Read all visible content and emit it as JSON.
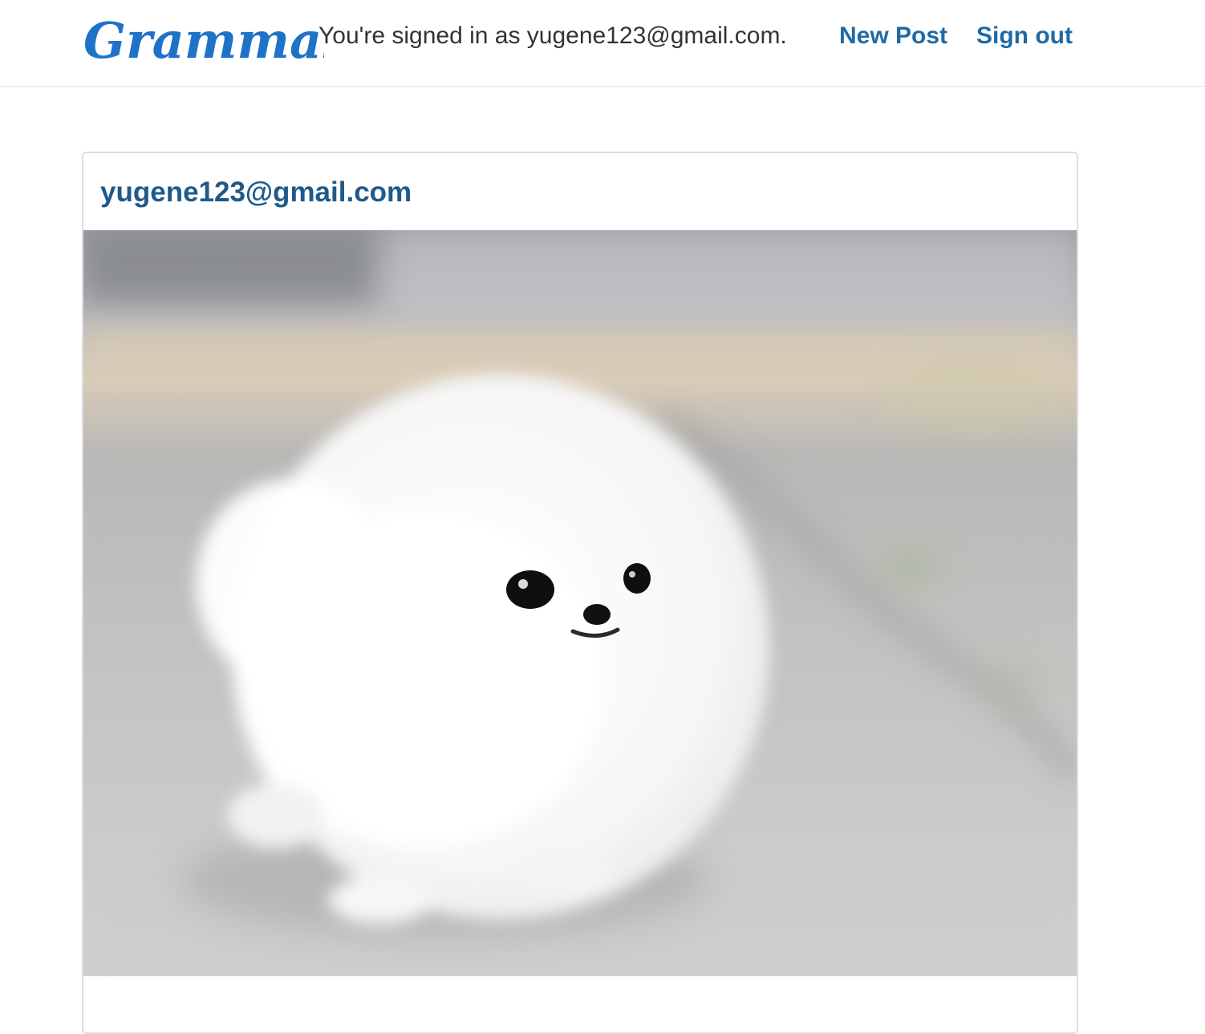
{
  "header": {
    "brand": "Grammable",
    "signed_in_text": "You're signed in as yugene123@gmail.com.",
    "new_post_label": "New Post",
    "sign_out_label": "Sign out"
  },
  "post": {
    "author": "yugene123@gmail.com",
    "image_subject": "fluffy white pomeranian puppy on pavement"
  },
  "colors": {
    "brand": "#1e73c8",
    "link": "#1f6aa5",
    "text": "#333333",
    "border": "#dddddd"
  }
}
